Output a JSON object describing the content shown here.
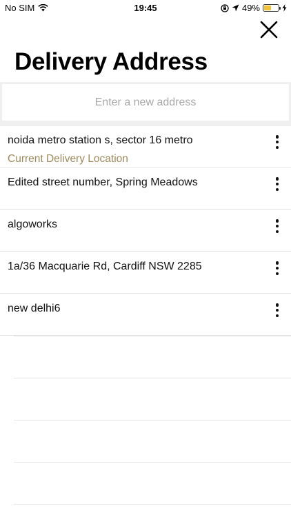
{
  "status_bar": {
    "carrier": "No SIM",
    "time": "19:45",
    "battery_percent": "49%",
    "battery_level": 0.49,
    "icons": [
      "wifi-icon",
      "rotation-lock-icon",
      "location-arrow-icon",
      "battery-icon",
      "charging-bolt-icon"
    ]
  },
  "header": {
    "title": "Delivery Address",
    "close_icon": "close-icon"
  },
  "search": {
    "placeholder": "Enter a new address"
  },
  "addresses": [
    {
      "label": "noida metro station s, sector 16 metro",
      "sublabel": "Current Delivery Location"
    },
    {
      "label": "Edited street number, Spring Meadows"
    },
    {
      "label": "algoworks"
    },
    {
      "label": "1a/36 Macquarie Rd, Cardiff NSW 2285"
    },
    {
      "label": "new delhi6"
    }
  ],
  "colors": {
    "accent_current": "#9d8a5c",
    "battery": "#f2c232"
  }
}
